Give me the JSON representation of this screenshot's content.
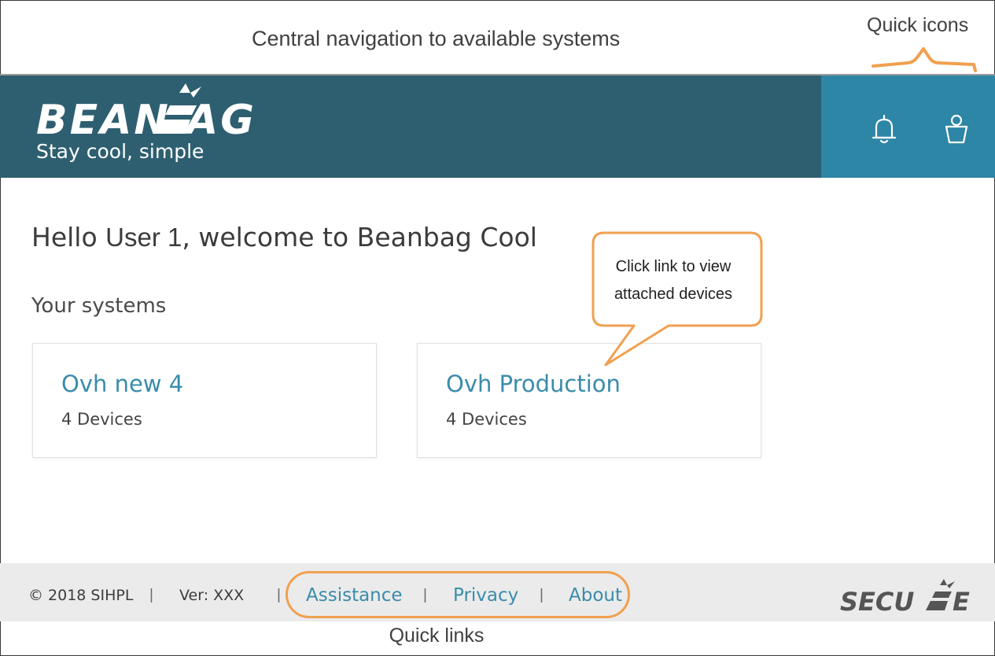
{
  "annotations": {
    "top_callout": "Central navigation to available systems",
    "quick_icons": "Quick icons",
    "tooltip_line1": "Click link to view",
    "tooltip_line2": "attached devices",
    "quick_links": "Quick links",
    "accent_color": "#f0a050"
  },
  "header": {
    "logo_text": "BEANBAG",
    "tagline": "Stay cool, simple",
    "background_color": "#2e5f70",
    "icons_panel_color": "#2d86a5",
    "icons": [
      "bell-icon",
      "user-icon"
    ]
  },
  "main": {
    "greeting_prefix": "Hello ",
    "user_name": "User 1",
    "greeting_suffix": ", welcome to Beanbag Cool",
    "section_title": "Your systems",
    "systems": [
      {
        "name": "Ovh new 4",
        "devices": "4 Devices"
      },
      {
        "name": "Ovh Production",
        "devices": "4 Devices"
      }
    ],
    "link_color": "#3a8cab"
  },
  "footer": {
    "copyright": "© 2018 SIHPL",
    "separator": "|",
    "version": "Ver: XXX",
    "links": [
      "Assistance",
      "Privacy",
      "About"
    ],
    "brand_logo_text": "SECURE"
  }
}
